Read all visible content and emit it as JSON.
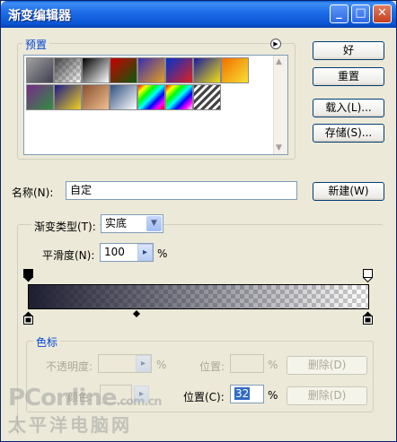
{
  "window": {
    "title": "渐变编辑器",
    "minimize": "_",
    "maximize": "□",
    "close": "✕"
  },
  "presets": {
    "label": "预置",
    "swatches": [
      [
        "#a0a0a0",
        "#404050"
      ],
      [
        "checker",
        "#555"
      ],
      [
        "#000",
        "#fff"
      ],
      [
        "#c00",
        "#0a5a0a"
      ],
      [
        "#3a2bb0",
        "#e2a021"
      ],
      [
        "#0033cc",
        "#e02020"
      ],
      [
        "#1a1aa0",
        "#f0e010"
      ],
      [
        "#f07000",
        "#f8e030"
      ],
      [
        "#7a2a8a",
        "#2f8f3f"
      ],
      [
        "#1a1a8a",
        "#f0d020"
      ],
      [
        "#8a5030",
        "#f0c090"
      ],
      [
        "#305080",
        "#ffffff"
      ],
      [
        "rainbow",
        "#ff0"
      ],
      [
        "rainbow2",
        "#fff"
      ],
      [
        "stripes",
        "#555"
      ]
    ]
  },
  "buttons": {
    "ok": "好",
    "reset": "重置",
    "load": "载入(L)...",
    "save": "存储(S)...",
    "new": "新建(W)",
    "delete_opacity": "删除(D)",
    "delete_color": "删除(D)"
  },
  "name": {
    "label": "名称(N):",
    "value": "自定"
  },
  "gradient": {
    "type_label": "渐变类型(T):",
    "type_value": "实底",
    "smooth_label": "平滑度(N):",
    "smooth_value": "100",
    "smooth_unit": "%"
  },
  "stops": {
    "group_label": "色标",
    "opacity_label": "不透明度:",
    "opacity_unit": "%",
    "opacity_location_label": "位置:",
    "opacity_location_unit": "%",
    "color_label": "颜色:",
    "color_location_label": "位置(C):",
    "color_location_value": "32",
    "color_location_unit": "%"
  },
  "watermark": {
    "brand": "PConline",
    "suffix": ".com.cn",
    "sub": "太平洋电脑网"
  }
}
